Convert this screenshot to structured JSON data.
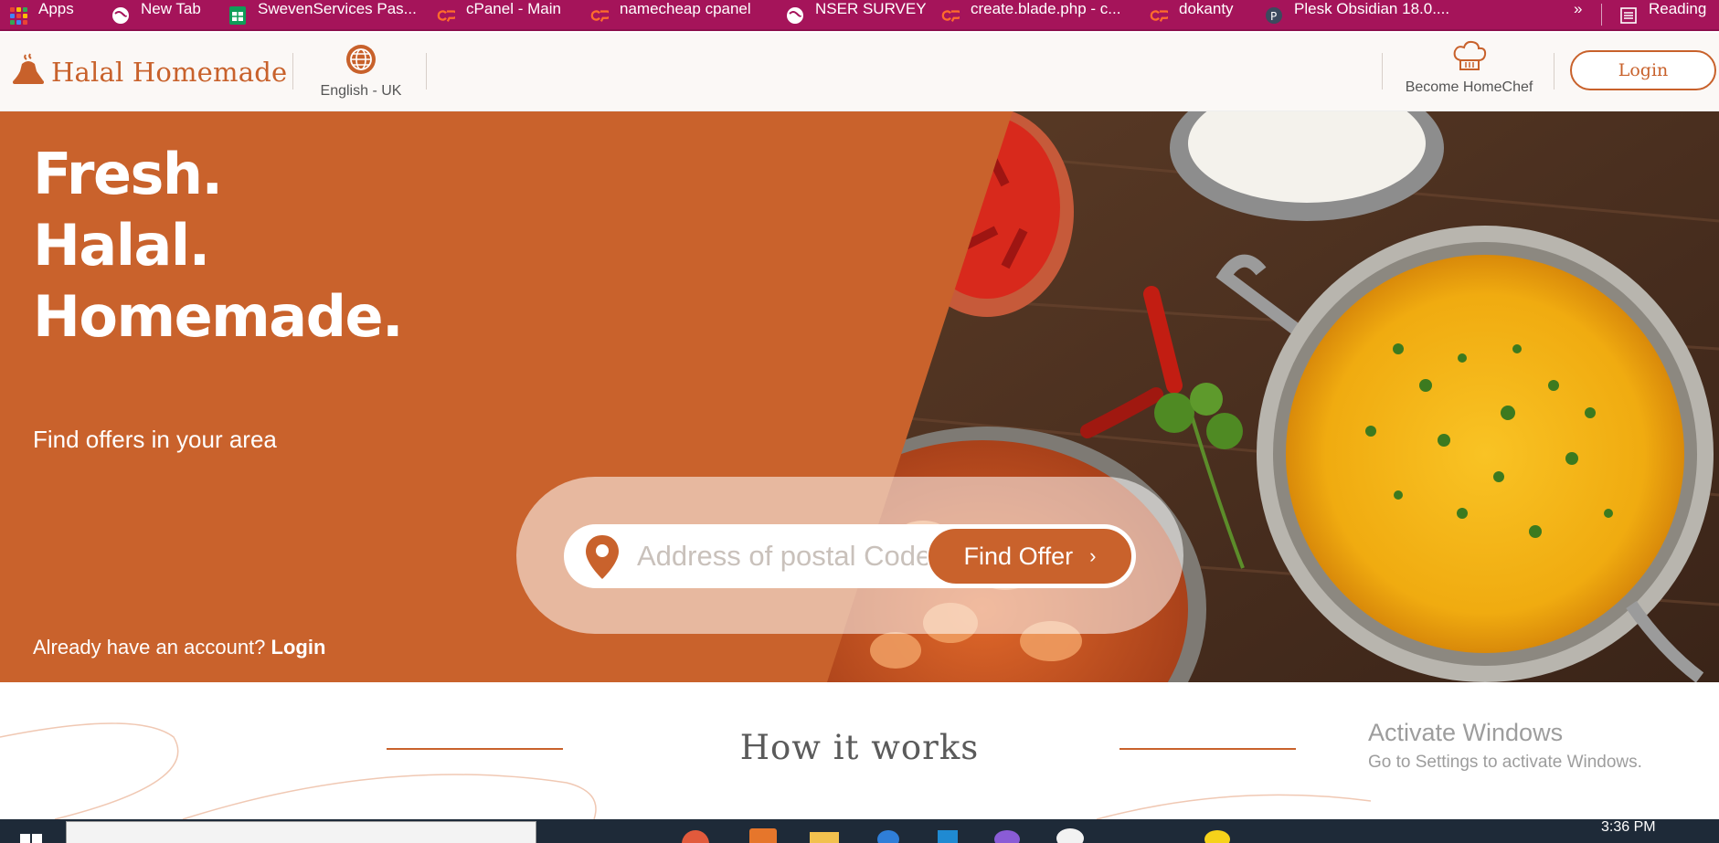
{
  "bookmarks": [
    {
      "label": "Apps",
      "icon": "apps-grid-icon"
    },
    {
      "label": "New Tab",
      "icon": "globe-icon"
    },
    {
      "label": "SwevenServices Pas...",
      "icon": "sheets-icon"
    },
    {
      "label": "cPanel - Main",
      "icon": "cpanel-icon"
    },
    {
      "label": "namecheap cpanel",
      "icon": "cpanel-icon"
    },
    {
      "label": "NSER SURVEY",
      "icon": "globe-icon"
    },
    {
      "label": "create.blade.php - c...",
      "icon": "cpanel-icon"
    },
    {
      "label": "dokanty",
      "icon": "cpanel-icon"
    },
    {
      "label": "Plesk Obsidian 18.0....",
      "icon": "plesk-icon"
    }
  ],
  "bookmarks_more": "»",
  "reading_list": "Reading",
  "header": {
    "brand": "Halal Homemade",
    "language": "English - UK",
    "become_chef": "Become HomeChef",
    "login": "Login"
  },
  "hero": {
    "line1": "Fresh.",
    "line2": "Halal.",
    "line3": "Homemade.",
    "subtitle": "Find offers in your area",
    "search_placeholder": "Address of postal Code",
    "find_button": "Find Offer",
    "already_text": "Already have an account? ",
    "already_login": "Login"
  },
  "how_it_works": {
    "title": "How it works"
  },
  "watermark": {
    "line1": "Activate Windows",
    "line2": "Go to Settings to activate Windows."
  },
  "taskbar": {
    "clock": "3:36 PM"
  },
  "colors": {
    "brand": "#c9622c",
    "bookmarks_bar": "#a5145a"
  }
}
